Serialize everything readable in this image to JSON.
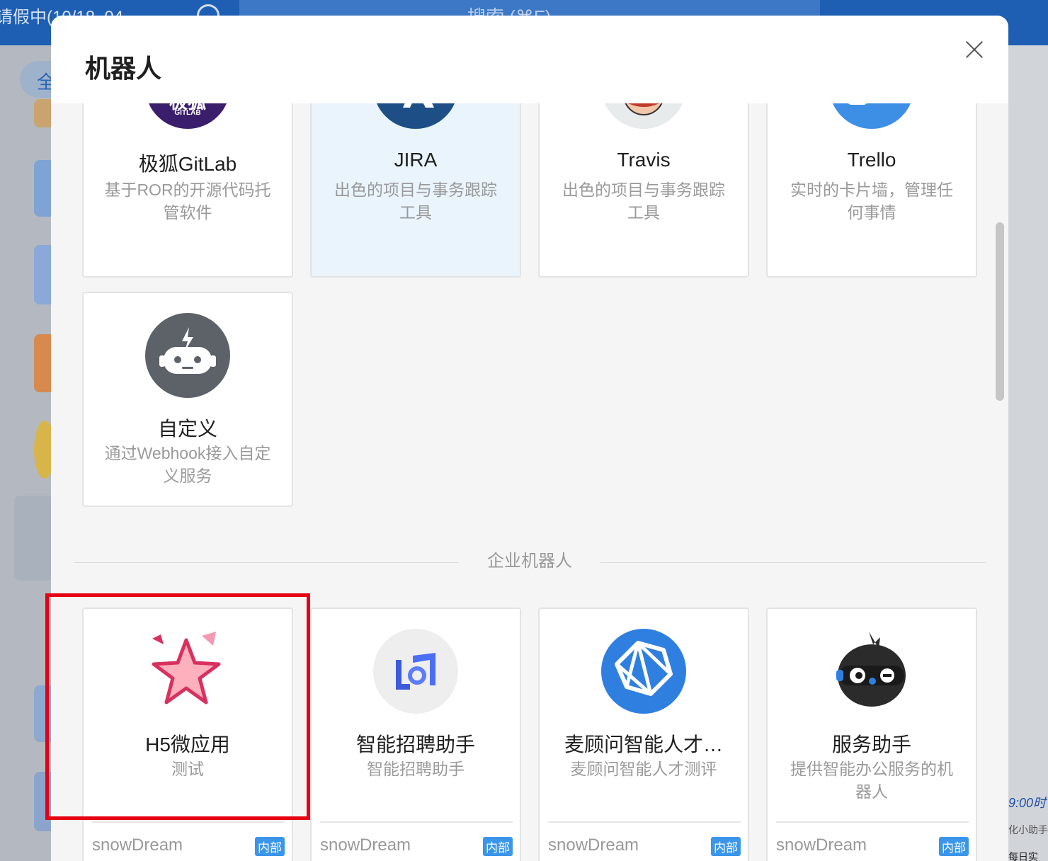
{
  "background": {
    "status_text": "请假中(10/18–04",
    "search_text": "搜索 (⌘F)",
    "tab_label": "全",
    "right_texts": [
      "9:00时",
      "化小助手",
      "每日实"
    ]
  },
  "modal": {
    "title": "机器人",
    "close_icon": "close-icon"
  },
  "bots": [
    {
      "name": "极狐GitLab",
      "desc": "基于ROR的开源代码托管软件",
      "logo": "gitlab-fox-icon",
      "logo_text": "极狐",
      "logo_subtext": "GITLAB"
    },
    {
      "name": "JIRA",
      "desc": "出色的项目与事务跟踪工具",
      "logo": "jira-icon"
    },
    {
      "name": "Travis",
      "desc": "出色的项目与事务跟踪工具",
      "logo": "travis-mascot-icon"
    },
    {
      "name": "Trello",
      "desc": "实时的卡片墙，管理任何事情",
      "logo": "trello-icon"
    },
    {
      "name": "自定义",
      "desc": "通过Webhook接入自定义服务",
      "logo": "robot-icon"
    }
  ],
  "enterprise_section": {
    "title": "企业机器人"
  },
  "enterprise_bots": [
    {
      "name": "H5微应用",
      "desc": "测试",
      "author": "snowDream",
      "badge": "内部",
      "logo": "star-icon"
    },
    {
      "name": "智能招聘助手",
      "desc": "智能招聘助手",
      "author": "snowDream",
      "badge": "内部",
      "logo": "recruit-icon"
    },
    {
      "name": "麦顾问智能人才…",
      "desc": "麦顾问智能人才测评",
      "author": "snowDream",
      "badge": "内部",
      "logo": "polygon-icon"
    },
    {
      "name": "服务助手",
      "desc": "提供智能办公服务的机器人",
      "author": "snowDream",
      "badge": "内部",
      "logo": "service-mascot-icon"
    }
  ],
  "colors": {
    "brand_blue": "#1e5fb3",
    "badge_blue": "#3b95ea",
    "highlight_red": "#e60012",
    "selected_card_bg": "#e9f4fd"
  }
}
